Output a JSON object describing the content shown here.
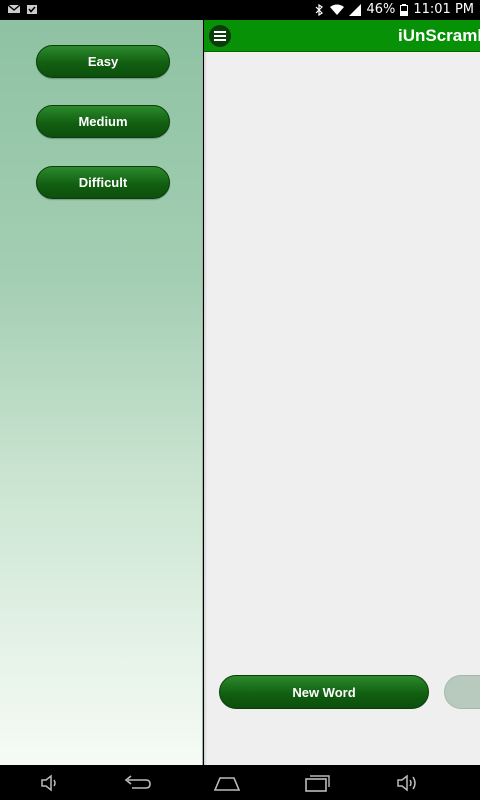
{
  "status_bar": {
    "battery": "46%",
    "time": "11:01 PM",
    "icons": [
      "gmail-icon",
      "checkbox-notification-icon",
      "bluetooth-icon",
      "wifi-icon",
      "signal-icon",
      "battery-icon"
    ]
  },
  "drawer": {
    "buttons": [
      {
        "label": "Easy"
      },
      {
        "label": "Medium"
      },
      {
        "label": "Difficult"
      }
    ]
  },
  "action_bar": {
    "title": "iUnScrambl",
    "color": "#079107"
  },
  "content": {
    "new_word_label": "New Word"
  },
  "nav_bar": {
    "icons": [
      "volume-down-icon",
      "back-icon",
      "home-icon",
      "recents-icon",
      "volume-up-icon"
    ]
  }
}
